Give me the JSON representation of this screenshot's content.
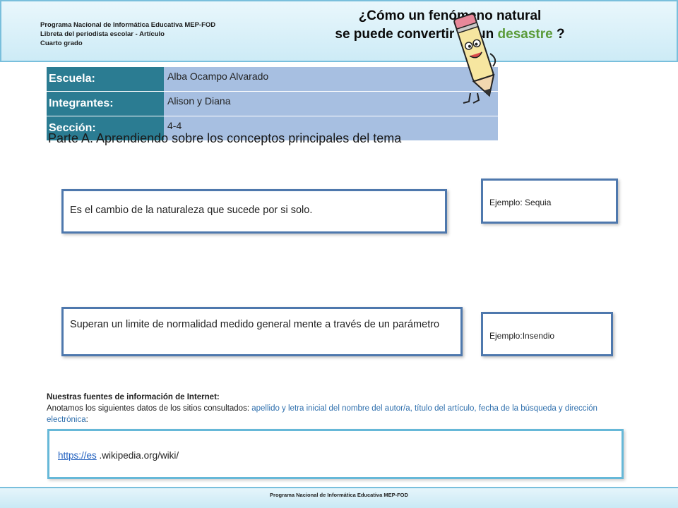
{
  "header": {
    "left_lines": [
      "Programa Nacional de Informática Educativa MEP-FOD",
      "Libreta del periodista escolar -  Artículo",
      "Cuarto grado"
    ],
    "title_line1": "¿Cómo un fenómeno natural",
    "title_line2_prefix": "se puede convertir en un ",
    "title_line2_accent": "desastre",
    "title_line2_suffix": " ?",
    "accent_color": "#5b9b3a"
  },
  "info_table": {
    "rows": [
      {
        "label": "Escuela:",
        "value": "Alba Ocampo Alvarado"
      },
      {
        "label": "Integrantes:",
        "value": "Alison y Diana"
      },
      {
        "label": "Sección:",
        "value": "4-4"
      }
    ]
  },
  "section_title": "Parte A.  Aprendiendo sobre los conceptos principales del tema",
  "definitions": {
    "def1": "Es el cambio de la naturaleza que sucede por si solo.",
    "def2": "Superan un limite de normalidad medido general mente a través de un parámetro",
    "example1": "Ejemplo: Sequia",
    "example2": "Ejemplo:Insendio"
  },
  "sources": {
    "title": "Nuestras fuentes de información de Internet:",
    "intro": "Anotamos los siguientes datos de los sitios consultados: ",
    "fields": "apellido y letra inicial del nombre del autor/a,  título del artículo, fecha de la búsqueda y dirección electrónica",
    "colon": ":",
    "link_text": "https://es",
    "link_rest": " .wikipedia.org/wiki/"
  },
  "footer": {
    "text": "Programa  Nacional de Informática  Educativa  MEP-FOD"
  }
}
